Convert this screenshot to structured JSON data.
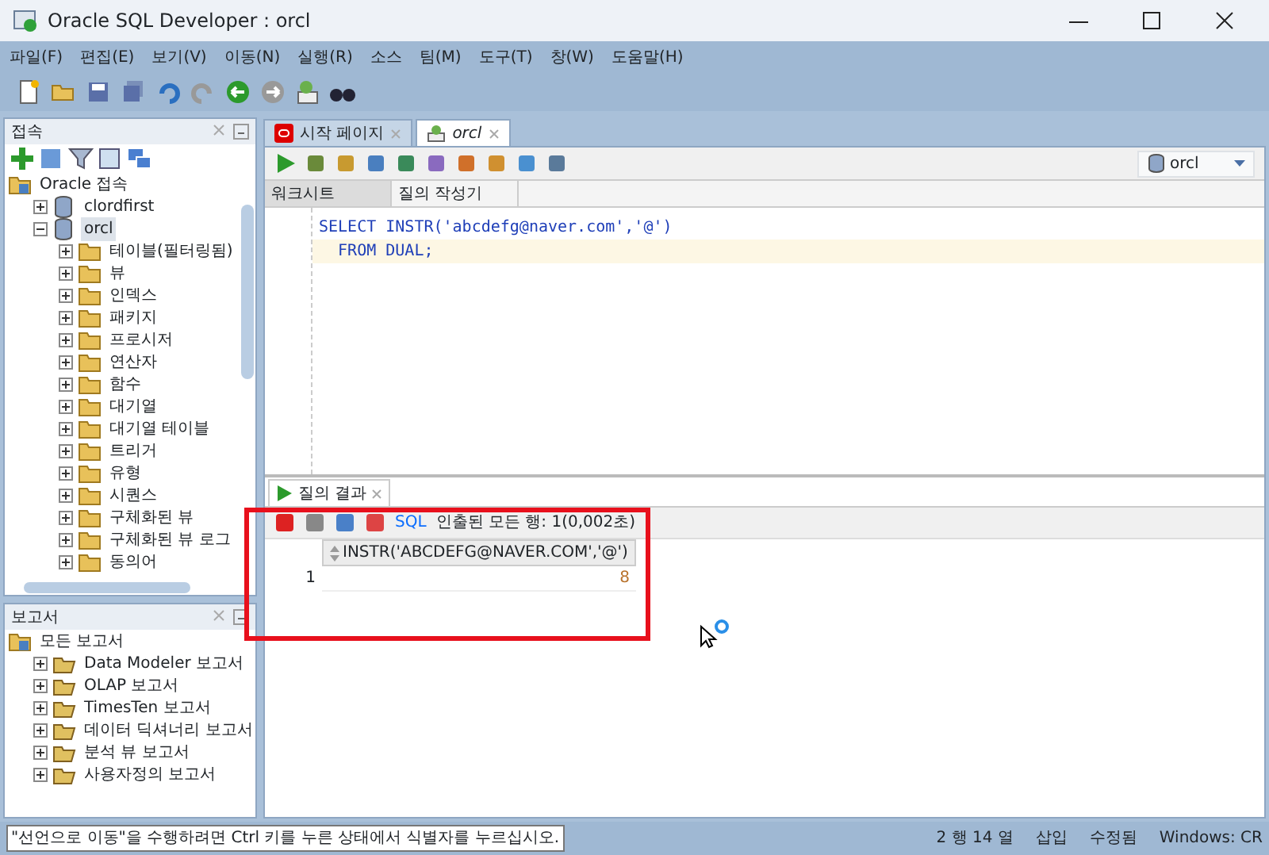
{
  "window": {
    "title": "Oracle SQL Developer : orcl"
  },
  "menu": [
    "파일(F)",
    "편집(E)",
    "보기(V)",
    "이동(N)",
    "실행(R)",
    "소스",
    "팀(M)",
    "도구(T)",
    "창(W)",
    "도움말(H)"
  ],
  "connections": {
    "title": "접속",
    "tree": [
      {
        "label": "Oracle 접속",
        "kind": "root",
        "children": [
          {
            "label": "clordfirst",
            "kind": "db",
            "expanded": false,
            "selected": false
          },
          {
            "label": "orcl",
            "kind": "db",
            "expanded": true,
            "selected": true,
            "children": [
              {
                "label": "테이블(필터링됨)",
                "kind": "folder",
                "expanded": false
              },
              {
                "label": "뷰",
                "kind": "folder",
                "expanded": false
              },
              {
                "label": "인덱스",
                "kind": "folder",
                "expanded": false
              },
              {
                "label": "패키지",
                "kind": "folder",
                "expanded": false
              },
              {
                "label": "프로시저",
                "kind": "folder",
                "expanded": false
              },
              {
                "label": "연산자",
                "kind": "folder",
                "expanded": false
              },
              {
                "label": "함수",
                "kind": "folder",
                "expanded": false
              },
              {
                "label": "대기열",
                "kind": "folder",
                "expanded": false
              },
              {
                "label": "대기열 테이블",
                "kind": "folder",
                "expanded": false
              },
              {
                "label": "트리거",
                "kind": "folder",
                "expanded": false
              },
              {
                "label": "유형",
                "kind": "folder",
                "expanded": false
              },
              {
                "label": "시퀀스",
                "kind": "folder",
                "expanded": false
              },
              {
                "label": "구체화된 뷰",
                "kind": "folder",
                "expanded": false
              },
              {
                "label": "구체화된 뷰 로그",
                "kind": "folder",
                "expanded": false
              },
              {
                "label": "동의어",
                "kind": "folder",
                "expanded": false
              }
            ]
          }
        ]
      }
    ]
  },
  "reports": {
    "title": "보고서",
    "tree": [
      {
        "label": "모든 보고서",
        "kind": "root",
        "children": [
          {
            "label": "Data Modeler 보고서",
            "kind": "report",
            "expanded": false
          },
          {
            "label": "OLAP 보고서",
            "kind": "report",
            "expanded": false
          },
          {
            "label": "TimesTen 보고서",
            "kind": "report",
            "expanded": false
          },
          {
            "label": "데이터 딕셔너리 보고서",
            "kind": "report",
            "expanded": false
          },
          {
            "label": "분석 뷰 보고서",
            "kind": "report",
            "expanded": false
          },
          {
            "label": "사용자정의 보고서",
            "kind": "report",
            "expanded": false
          }
        ]
      }
    ]
  },
  "editor_tabs": [
    {
      "label": "시작 페이지",
      "selected": false
    },
    {
      "label": "orcl",
      "selected": true
    }
  ],
  "connection_select": {
    "value": "orcl"
  },
  "worksheet_tabs": [
    {
      "label": "워크시트",
      "selected": true
    },
    {
      "label": "질의 작성기",
      "selected": false
    }
  ],
  "code_lines": [
    {
      "text": "SELECT INSTR('abcdefg@naver.com','@')",
      "current": false
    },
    {
      "text": "  FROM DUAL;",
      "current": true
    }
  ],
  "results": {
    "tab": "질의 결과",
    "sql_link": "SQL",
    "status": "인출된 모든 행: 1(0,002초)",
    "columns": [
      "INSTR('ABCDEFG@NAVER.COM','@')"
    ],
    "rows": [
      {
        "number": "1",
        "cells": [
          "8"
        ]
      }
    ]
  },
  "status_bar": {
    "message": "\"선언으로 이동\"을 수행하려면 Ctrl 키를 누른 상태에서 식별자를 누르십시오.",
    "position": "2 행 14 열",
    "mode": "삽입",
    "modified": "수정됨",
    "line_ending": "Windows: CR"
  }
}
